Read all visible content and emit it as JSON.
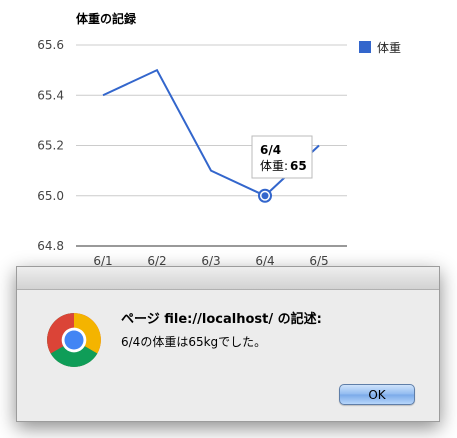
{
  "chart_data": {
    "type": "line",
    "title": "体重の記録",
    "categories": [
      "6/1",
      "6/2",
      "6/3",
      "6/4",
      "6/5"
    ],
    "series": [
      {
        "name": "体重",
        "values": [
          65.4,
          65.5,
          65.1,
          65.0,
          65.2
        ],
        "color": "#3366cc"
      }
    ],
    "ylim": [
      64.8,
      65.6
    ],
    "yticks": [
      "65.6",
      "65.4",
      "65.2",
      "65.0",
      "64.8"
    ],
    "grid": true,
    "legend_position": "right",
    "tooltip": {
      "category": "6/4",
      "series_label": "体重:",
      "value": "65"
    }
  },
  "dialog": {
    "heading": "ページ file://localhost/ の記述:",
    "message": "6/4の体重は65kgでした。",
    "ok_label": "OK",
    "icon": "chrome-icon"
  },
  "colors": {
    "line": "#3366cc",
    "dialog_bg": "#ececec",
    "ok_button": "#8fbaf0"
  }
}
